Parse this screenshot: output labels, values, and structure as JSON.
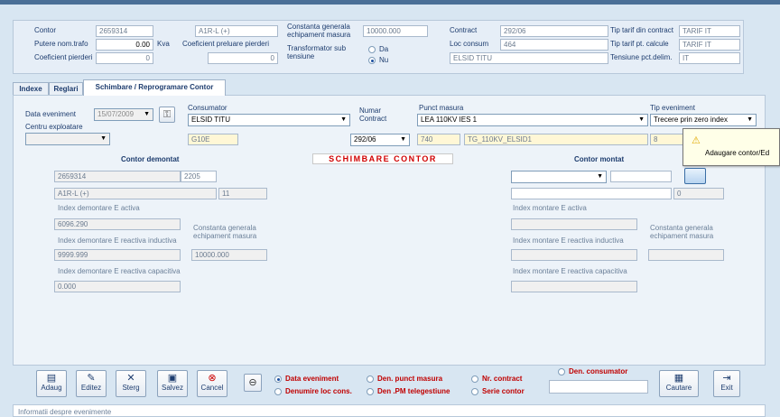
{
  "header": {
    "contor_label": "Contor",
    "contor_value": "2659314",
    "contor_type": "A1R-L (+)",
    "putere_label": "Putere nom.trafo",
    "putere_value": "0.00",
    "putere_unit": "Kva",
    "coef_prel_label": "Coeficient preluare pierderi",
    "coef_prel_value": "0",
    "coef_pierderi_label": "Coeficient pierderi",
    "coef_pierderi_value": "0",
    "constanta_label_1": "Constanta generala",
    "constanta_label_2": "echipament masura",
    "constanta_value": "10000.000",
    "transformator_label_1": "Transformator sub",
    "transformator_label_2": "tensiune",
    "da_label": "Da",
    "nu_label": "Nu",
    "contract_label": "Contract",
    "contract_value": "292/06",
    "loc_consum_label": "Loc consum",
    "loc_consum_value": "464",
    "loc_consum_name": "ELSID TITU",
    "tip_tarif_contract_label": "Tip tarif din contract",
    "tip_tarif_contract_value": "TARIF IT",
    "tip_tarif_calcule_label": "Tip tarif pt. calcule",
    "tip_tarif_calcule_value": "TARIF IT",
    "tensiune_label": "Tensiune pct.delim.",
    "tensiune_value": "IT"
  },
  "tabs": [
    "Indexe",
    "Reglari",
    "Schimbare / Reprogramare Contor"
  ],
  "form": {
    "data_eveniment_label": "Data eveniment",
    "data_eveniment_value": "15/07/2009",
    "centru_label": "Centru exploatare",
    "consumator_label": "Consumator",
    "consumator_value": "ELSID TITU",
    "consumator_code": "G10E",
    "numar_contract_label_1": "Numar",
    "numar_contract_label_2": "Contract",
    "numar_contract_value": "292/06",
    "punct_masura_label": "Punct masura",
    "punct_masura_value": "LEA 110KV IES 1",
    "punct_code": "740",
    "punct_name": "TG_110KV_ELSID1",
    "tip_eveniment_label": "Tip eveniment",
    "tip_eveniment_value": "Trecere prin zero index",
    "tip_code": "8",
    "section_title": "SCHIMBARE CONTOR",
    "tooltip": "Adaugare contor/Ed"
  },
  "demontat": {
    "title": "Contor demontat",
    "serie": "2659314",
    "cod": "2205",
    "tip": "A1R-L (+)",
    "nr": "11",
    "idx_activa_label": "Index demontare E activa",
    "idx_activa_value": "6096.290",
    "idx_inductiva_label": "Index demontare E reactiva inductiva",
    "idx_inductiva_value": "9999.999",
    "constanta_label_1": "Constanta generala",
    "constanta_label_2": "echipament masura",
    "constanta_value": "10000.000",
    "idx_capacitiva_label": "Index demontare E reactiva capacitiva",
    "idx_capacitiva_value": "0.000"
  },
  "montat": {
    "title": "Contor montat",
    "nr": "0",
    "idx_activa_label": "Index montare E activa",
    "idx_inductiva_label": "Index montare E reactiva inductiva",
    "constanta_label_1": "Constanta generala",
    "constanta_label_2": "echipament masura",
    "idx_capacitiva_label": "Index montare E reactiva capacitiva"
  },
  "toolbar": {
    "adaug": "Adaug",
    "editez": "Editez",
    "sterg": "Sterg",
    "salvez": "Salvez",
    "cancel": "Cancel",
    "cautare": "Cautare",
    "exit": "Exit"
  },
  "search": {
    "data_eveniment": "Data eveniment",
    "denumire_loc": "Denumire  loc cons.",
    "den_punct": "Den. punct masura",
    "den_pm": "Den .PM telegestiune",
    "nr_contract": "Nr. contract",
    "serie_contor": "Serie contor",
    "den_consumator": "Den. consumator"
  },
  "bottom": {
    "info_label": "Informatii despre evenimente"
  }
}
